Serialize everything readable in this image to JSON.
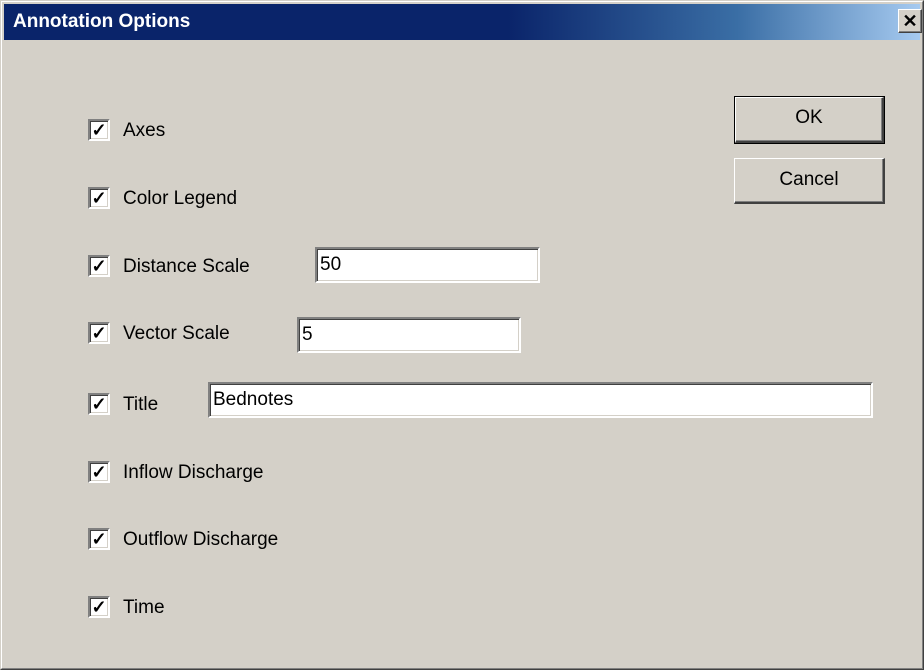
{
  "window": {
    "title": "Annotation Options",
    "close_glyph": "✕"
  },
  "options": [
    {
      "label": "Axes",
      "checked": true
    },
    {
      "label": "Color Legend",
      "checked": true
    },
    {
      "label": "Distance Scale",
      "checked": true,
      "value": "50"
    },
    {
      "label": "Vector Scale",
      "checked": true,
      "value": "5"
    },
    {
      "label": "Title",
      "checked": true,
      "value": "Bednotes"
    },
    {
      "label": "Inflow Discharge",
      "checked": true
    },
    {
      "label": "Outflow Discharge",
      "checked": true
    },
    {
      "label": "Time",
      "checked": true
    }
  ],
  "buttons": {
    "ok": "OK",
    "cancel": "Cancel"
  },
  "check_glyph": "✓",
  "colors": {
    "titlebar": "#0a246a",
    "face": "#d4d0c8"
  }
}
